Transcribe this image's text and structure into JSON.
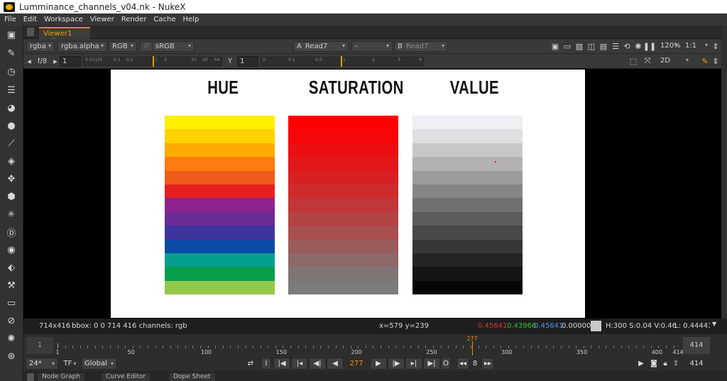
{
  "window": {
    "title": "Lumminance_channels_v04.nk - NukeX"
  },
  "menu": [
    "File",
    "Edit",
    "Workspace",
    "Viewer",
    "Render",
    "Cache",
    "Help"
  ],
  "tab": {
    "label": "Viewer1",
    "close": "✖"
  },
  "controls": {
    "channels": "rgba",
    "alpha_channel": "rgba.alpha",
    "display_channel": "RGB",
    "ip": "IP",
    "colorspace": "sRGB",
    "input_a_letter": "A",
    "input_a": "Read7",
    "compare_op": "-",
    "input_b_letter": "B",
    "input_b": "Read7",
    "zoom": "120%",
    "ratio": "1:1",
    "fstop": "f/8",
    "gain_value": "1",
    "gamma_label": "Y",
    "gamma_value": "1",
    "view_mode": "2D",
    "gain_ticks": [
      "0.03125",
      "0.1",
      "0.2",
      "1",
      "3",
      "10",
      "20",
      "64"
    ],
    "gamma_ticks": [
      "0",
      "0.1",
      "0.5",
      "1",
      "2",
      "3",
      "4"
    ]
  },
  "image": {
    "headings": {
      "hue": "HUE",
      "saturation": "SATURATION",
      "value": "VALUE"
    },
    "hue_swatches": [
      "#fff000",
      "#ffd200",
      "#ffab00",
      "#ff7a10",
      "#ef5b1a",
      "#e3201e",
      "#8e2390",
      "#6b2c95",
      "#3f349c",
      "#0b4aa6",
      "#05a08c",
      "#0a9f4c",
      "#93c94a"
    ],
    "saturation_swatches": [
      "#ff0000",
      "#f60608",
      "#ec0f12",
      "#e2171a",
      "#d82022",
      "#ce2b2d",
      "#c13638",
      "#b44344",
      "#a84f50",
      "#9a5b5c",
      "#8d6969",
      "#827474",
      "#7b7b7b"
    ],
    "value_swatches": [
      "#f0eef2",
      "#e1dee2",
      "#c9c7ca",
      "#b3b1b4",
      "#9c9b9d",
      "#868587",
      "#707071",
      "#5c5c5d",
      "#494949",
      "#363637",
      "#252525",
      "#151515",
      "#060606"
    ]
  },
  "info": {
    "format": "714x416",
    "bbox": "bbox: 0 0 714 416 channels: rgb",
    "coords": "x=579 y=239",
    "r": "0.45641",
    "g": "0.43966",
    "b": "0.45641",
    "a": "0.00000",
    "hsv": "H:300 S:0.04 V:0.46",
    "luminance": "L: 0.44443",
    "color_r": "#e03030",
    "color_g": "#30c030",
    "color_b": "#4f8fe8"
  },
  "timeline": {
    "start": "1",
    "end": "414",
    "current": "277",
    "labels": [
      "1",
      "50",
      "100",
      "150",
      "200",
      "250",
      "300",
      "350",
      "400",
      "414"
    ],
    "label_frames": [
      1,
      50,
      100,
      150,
      200,
      250,
      300,
      350,
      400,
      414
    ],
    "first_frame": 1,
    "last_frame": 414,
    "current_frame": 277
  },
  "playback": {
    "fps": "24*",
    "mode": "TF",
    "scope": "Global",
    "frame_field": "277",
    "increment": "8",
    "end_field": "414",
    "in_mark": "I",
    "out_mark": "O"
  },
  "bottom_tabs": [
    "Node Graph",
    "Curve Editor",
    "Dope Sheet"
  ]
}
